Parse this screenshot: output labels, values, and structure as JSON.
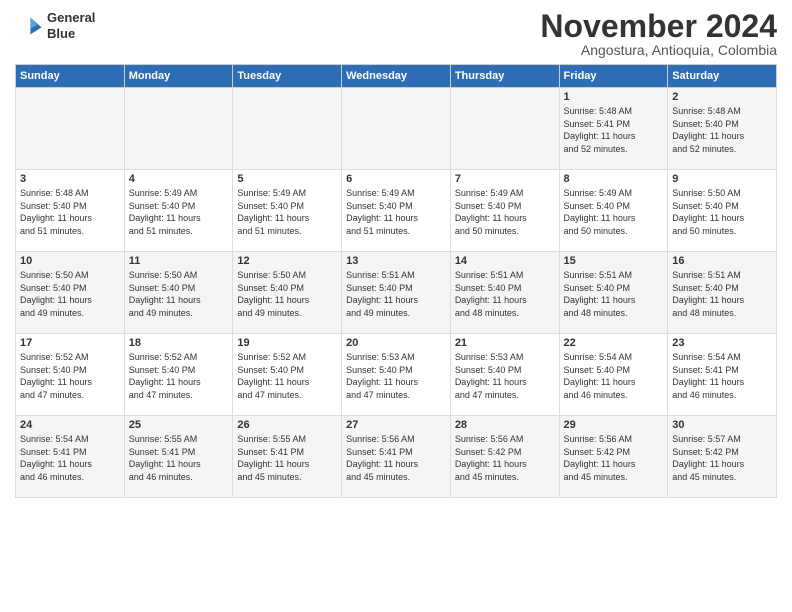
{
  "header": {
    "logo_line1": "General",
    "logo_line2": "Blue",
    "month": "November 2024",
    "location": "Angostura, Antioquia, Colombia"
  },
  "days_of_week": [
    "Sunday",
    "Monday",
    "Tuesday",
    "Wednesday",
    "Thursday",
    "Friday",
    "Saturday"
  ],
  "weeks": [
    [
      {
        "day": "",
        "info": ""
      },
      {
        "day": "",
        "info": ""
      },
      {
        "day": "",
        "info": ""
      },
      {
        "day": "",
        "info": ""
      },
      {
        "day": "",
        "info": ""
      },
      {
        "day": "1",
        "info": "Sunrise: 5:48 AM\nSunset: 5:41 PM\nDaylight: 11 hours\nand 52 minutes."
      },
      {
        "day": "2",
        "info": "Sunrise: 5:48 AM\nSunset: 5:40 PM\nDaylight: 11 hours\nand 52 minutes."
      }
    ],
    [
      {
        "day": "3",
        "info": "Sunrise: 5:48 AM\nSunset: 5:40 PM\nDaylight: 11 hours\nand 51 minutes."
      },
      {
        "day": "4",
        "info": "Sunrise: 5:49 AM\nSunset: 5:40 PM\nDaylight: 11 hours\nand 51 minutes."
      },
      {
        "day": "5",
        "info": "Sunrise: 5:49 AM\nSunset: 5:40 PM\nDaylight: 11 hours\nand 51 minutes."
      },
      {
        "day": "6",
        "info": "Sunrise: 5:49 AM\nSunset: 5:40 PM\nDaylight: 11 hours\nand 51 minutes."
      },
      {
        "day": "7",
        "info": "Sunrise: 5:49 AM\nSunset: 5:40 PM\nDaylight: 11 hours\nand 50 minutes."
      },
      {
        "day": "8",
        "info": "Sunrise: 5:49 AM\nSunset: 5:40 PM\nDaylight: 11 hours\nand 50 minutes."
      },
      {
        "day": "9",
        "info": "Sunrise: 5:50 AM\nSunset: 5:40 PM\nDaylight: 11 hours\nand 50 minutes."
      }
    ],
    [
      {
        "day": "10",
        "info": "Sunrise: 5:50 AM\nSunset: 5:40 PM\nDaylight: 11 hours\nand 49 minutes."
      },
      {
        "day": "11",
        "info": "Sunrise: 5:50 AM\nSunset: 5:40 PM\nDaylight: 11 hours\nand 49 minutes."
      },
      {
        "day": "12",
        "info": "Sunrise: 5:50 AM\nSunset: 5:40 PM\nDaylight: 11 hours\nand 49 minutes."
      },
      {
        "day": "13",
        "info": "Sunrise: 5:51 AM\nSunset: 5:40 PM\nDaylight: 11 hours\nand 49 minutes."
      },
      {
        "day": "14",
        "info": "Sunrise: 5:51 AM\nSunset: 5:40 PM\nDaylight: 11 hours\nand 48 minutes."
      },
      {
        "day": "15",
        "info": "Sunrise: 5:51 AM\nSunset: 5:40 PM\nDaylight: 11 hours\nand 48 minutes."
      },
      {
        "day": "16",
        "info": "Sunrise: 5:51 AM\nSunset: 5:40 PM\nDaylight: 11 hours\nand 48 minutes."
      }
    ],
    [
      {
        "day": "17",
        "info": "Sunrise: 5:52 AM\nSunset: 5:40 PM\nDaylight: 11 hours\nand 47 minutes."
      },
      {
        "day": "18",
        "info": "Sunrise: 5:52 AM\nSunset: 5:40 PM\nDaylight: 11 hours\nand 47 minutes."
      },
      {
        "day": "19",
        "info": "Sunrise: 5:52 AM\nSunset: 5:40 PM\nDaylight: 11 hours\nand 47 minutes."
      },
      {
        "day": "20",
        "info": "Sunrise: 5:53 AM\nSunset: 5:40 PM\nDaylight: 11 hours\nand 47 minutes."
      },
      {
        "day": "21",
        "info": "Sunrise: 5:53 AM\nSunset: 5:40 PM\nDaylight: 11 hours\nand 47 minutes."
      },
      {
        "day": "22",
        "info": "Sunrise: 5:54 AM\nSunset: 5:40 PM\nDaylight: 11 hours\nand 46 minutes."
      },
      {
        "day": "23",
        "info": "Sunrise: 5:54 AM\nSunset: 5:41 PM\nDaylight: 11 hours\nand 46 minutes."
      }
    ],
    [
      {
        "day": "24",
        "info": "Sunrise: 5:54 AM\nSunset: 5:41 PM\nDaylight: 11 hours\nand 46 minutes."
      },
      {
        "day": "25",
        "info": "Sunrise: 5:55 AM\nSunset: 5:41 PM\nDaylight: 11 hours\nand 46 minutes."
      },
      {
        "day": "26",
        "info": "Sunrise: 5:55 AM\nSunset: 5:41 PM\nDaylight: 11 hours\nand 45 minutes."
      },
      {
        "day": "27",
        "info": "Sunrise: 5:56 AM\nSunset: 5:41 PM\nDaylight: 11 hours\nand 45 minutes."
      },
      {
        "day": "28",
        "info": "Sunrise: 5:56 AM\nSunset: 5:42 PM\nDaylight: 11 hours\nand 45 minutes."
      },
      {
        "day": "29",
        "info": "Sunrise: 5:56 AM\nSunset: 5:42 PM\nDaylight: 11 hours\nand 45 minutes."
      },
      {
        "day": "30",
        "info": "Sunrise: 5:57 AM\nSunset: 5:42 PM\nDaylight: 11 hours\nand 45 minutes."
      }
    ]
  ]
}
